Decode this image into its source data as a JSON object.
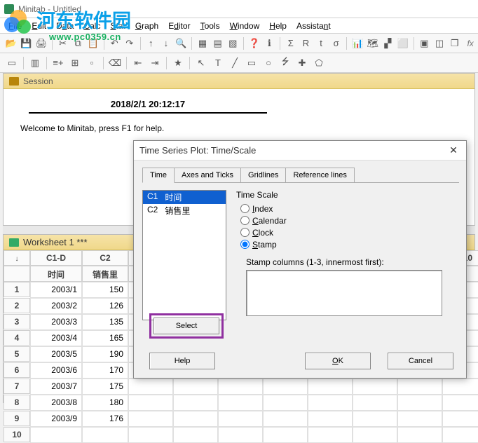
{
  "app": {
    "title": "Minitab - Untitled"
  },
  "menus": [
    "File",
    "Edit",
    "Data",
    "Calc",
    "Stat",
    "Graph",
    "Editor",
    "Tools",
    "Window",
    "Help",
    "Assistant"
  ],
  "session": {
    "title": "Session",
    "datetime": "2018/2/1 20:12:17",
    "welcome": "Welcome to Minitab, press F1 for help."
  },
  "worksheet": {
    "title": "Worksheet 1 ***",
    "col_headers": [
      "↓",
      "C1-D",
      "C2",
      "",
      "",
      "",
      "",
      "",
      "",
      "",
      "C10"
    ],
    "sub_headers": [
      "",
      "时间",
      "销售里",
      "",
      "",
      "",
      "",
      "",
      "",
      "",
      ""
    ],
    "rows": [
      [
        "1",
        "2003/1",
        "150"
      ],
      [
        "2",
        "2003/2",
        "126"
      ],
      [
        "3",
        "2003/3",
        "135"
      ],
      [
        "4",
        "2003/4",
        "165"
      ],
      [
        "5",
        "2003/5",
        "190"
      ],
      [
        "6",
        "2003/6",
        "170"
      ],
      [
        "7",
        "2003/7",
        "175"
      ],
      [
        "8",
        "2003/8",
        "180"
      ],
      [
        "9",
        "2003/9",
        "176"
      ],
      [
        "10",
        "",
        ""
      ]
    ]
  },
  "dialog": {
    "title": "Time Series Plot: Time/Scale",
    "tabs": [
      "Time",
      "Axes and Ticks",
      "Gridlines",
      "Reference lines"
    ],
    "active_tab": 0,
    "list": [
      {
        "col": "C1",
        "name": "时间",
        "selected": true
      },
      {
        "col": "C2",
        "name": "销售里",
        "selected": false
      }
    ],
    "timescale_label": "Time Scale",
    "radios": [
      "Index",
      "Calendar",
      "Clock",
      "Stamp"
    ],
    "radio_selected": 3,
    "stamp_label": "Stamp columns (1-3, innermost first):",
    "buttons": {
      "select": "Select",
      "help": "Help",
      "ok": "OK",
      "cancel": "Cancel"
    }
  },
  "watermark": {
    "brand": "河东软件园",
    "sub": "www.pc0359.cn"
  },
  "formula_label": "fx"
}
